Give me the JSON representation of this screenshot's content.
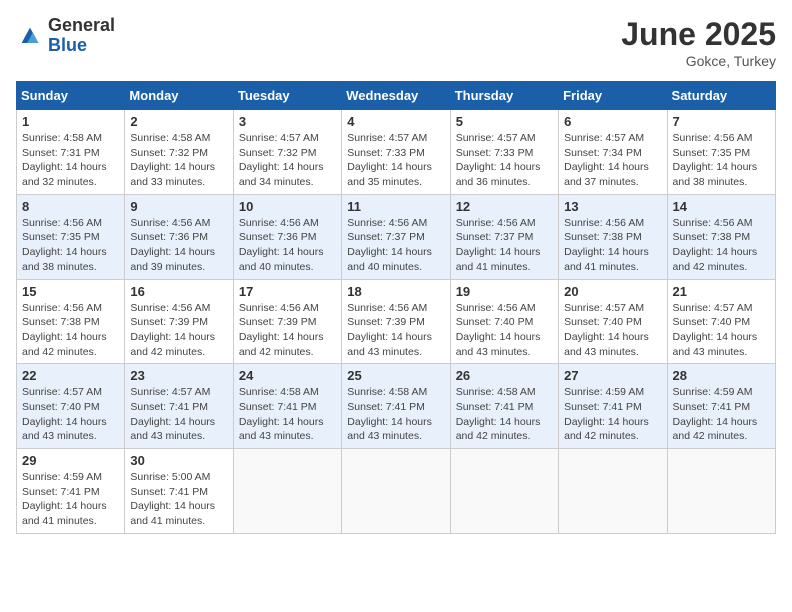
{
  "header": {
    "logo_general": "General",
    "logo_blue": "Blue",
    "month_title": "June 2025",
    "location": "Gokce, Turkey"
  },
  "weekdays": [
    "Sunday",
    "Monday",
    "Tuesday",
    "Wednesday",
    "Thursday",
    "Friday",
    "Saturday"
  ],
  "weeks": [
    [
      {
        "day": "1",
        "sunrise": "4:58 AM",
        "sunset": "7:31 PM",
        "daylight": "14 hours and 32 minutes."
      },
      {
        "day": "2",
        "sunrise": "4:58 AM",
        "sunset": "7:32 PM",
        "daylight": "14 hours and 33 minutes."
      },
      {
        "day": "3",
        "sunrise": "4:57 AM",
        "sunset": "7:32 PM",
        "daylight": "14 hours and 34 minutes."
      },
      {
        "day": "4",
        "sunrise": "4:57 AM",
        "sunset": "7:33 PM",
        "daylight": "14 hours and 35 minutes."
      },
      {
        "day": "5",
        "sunrise": "4:57 AM",
        "sunset": "7:33 PM",
        "daylight": "14 hours and 36 minutes."
      },
      {
        "day": "6",
        "sunrise": "4:57 AM",
        "sunset": "7:34 PM",
        "daylight": "14 hours and 37 minutes."
      },
      {
        "day": "7",
        "sunrise": "4:56 AM",
        "sunset": "7:35 PM",
        "daylight": "14 hours and 38 minutes."
      }
    ],
    [
      {
        "day": "8",
        "sunrise": "4:56 AM",
        "sunset": "7:35 PM",
        "daylight": "14 hours and 38 minutes."
      },
      {
        "day": "9",
        "sunrise": "4:56 AM",
        "sunset": "7:36 PM",
        "daylight": "14 hours and 39 minutes."
      },
      {
        "day": "10",
        "sunrise": "4:56 AM",
        "sunset": "7:36 PM",
        "daylight": "14 hours and 40 minutes."
      },
      {
        "day": "11",
        "sunrise": "4:56 AM",
        "sunset": "7:37 PM",
        "daylight": "14 hours and 40 minutes."
      },
      {
        "day": "12",
        "sunrise": "4:56 AM",
        "sunset": "7:37 PM",
        "daylight": "14 hours and 41 minutes."
      },
      {
        "day": "13",
        "sunrise": "4:56 AM",
        "sunset": "7:38 PM",
        "daylight": "14 hours and 41 minutes."
      },
      {
        "day": "14",
        "sunrise": "4:56 AM",
        "sunset": "7:38 PM",
        "daylight": "14 hours and 42 minutes."
      }
    ],
    [
      {
        "day": "15",
        "sunrise": "4:56 AM",
        "sunset": "7:38 PM",
        "daylight": "14 hours and 42 minutes."
      },
      {
        "day": "16",
        "sunrise": "4:56 AM",
        "sunset": "7:39 PM",
        "daylight": "14 hours and 42 minutes."
      },
      {
        "day": "17",
        "sunrise": "4:56 AM",
        "sunset": "7:39 PM",
        "daylight": "14 hours and 42 minutes."
      },
      {
        "day": "18",
        "sunrise": "4:56 AM",
        "sunset": "7:39 PM",
        "daylight": "14 hours and 43 minutes."
      },
      {
        "day": "19",
        "sunrise": "4:56 AM",
        "sunset": "7:40 PM",
        "daylight": "14 hours and 43 minutes."
      },
      {
        "day": "20",
        "sunrise": "4:57 AM",
        "sunset": "7:40 PM",
        "daylight": "14 hours and 43 minutes."
      },
      {
        "day": "21",
        "sunrise": "4:57 AM",
        "sunset": "7:40 PM",
        "daylight": "14 hours and 43 minutes."
      }
    ],
    [
      {
        "day": "22",
        "sunrise": "4:57 AM",
        "sunset": "7:40 PM",
        "daylight": "14 hours and 43 minutes."
      },
      {
        "day": "23",
        "sunrise": "4:57 AM",
        "sunset": "7:41 PM",
        "daylight": "14 hours and 43 minutes."
      },
      {
        "day": "24",
        "sunrise": "4:58 AM",
        "sunset": "7:41 PM",
        "daylight": "14 hours and 43 minutes."
      },
      {
        "day": "25",
        "sunrise": "4:58 AM",
        "sunset": "7:41 PM",
        "daylight": "14 hours and 43 minutes."
      },
      {
        "day": "26",
        "sunrise": "4:58 AM",
        "sunset": "7:41 PM",
        "daylight": "14 hours and 42 minutes."
      },
      {
        "day": "27",
        "sunrise": "4:59 AM",
        "sunset": "7:41 PM",
        "daylight": "14 hours and 42 minutes."
      },
      {
        "day": "28",
        "sunrise": "4:59 AM",
        "sunset": "7:41 PM",
        "daylight": "14 hours and 42 minutes."
      }
    ],
    [
      {
        "day": "29",
        "sunrise": "4:59 AM",
        "sunset": "7:41 PM",
        "daylight": "14 hours and 41 minutes."
      },
      {
        "day": "30",
        "sunrise": "5:00 AM",
        "sunset": "7:41 PM",
        "daylight": "14 hours and 41 minutes."
      },
      null,
      null,
      null,
      null,
      null
    ]
  ]
}
